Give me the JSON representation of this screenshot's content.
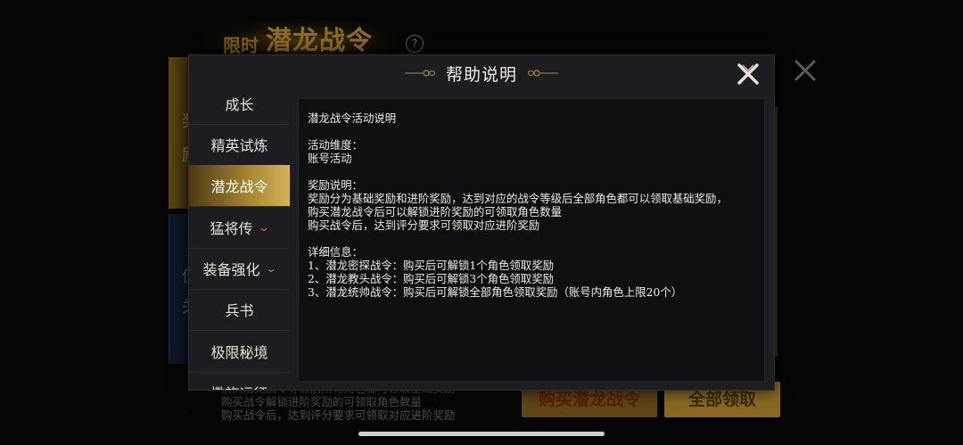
{
  "background": {
    "title_small": "限时",
    "title_large": "潜龙战令",
    "help_icon": "?",
    "left_panel_chars_top": [
      "奖",
      "励"
    ],
    "left_panel_chars_bottom": [
      "值",
      "关"
    ],
    "behind_text": [
      "购买潜龙战令等级后所有角色都可领取基础奖励",
      "购买战令解锁进阶奖励的可领取角色数量",
      "购买战令后，达到评分要求可领取对应进阶奖励"
    ],
    "buy_button": "购买潜龙战令",
    "claim_all_button": "全部领取"
  },
  "dialog": {
    "title": "帮助说明",
    "close_icon": "close-x-icon",
    "sidebar": [
      {
        "label": "成长",
        "active": false,
        "chevron": false
      },
      {
        "label": "精英试炼",
        "active": false,
        "chevron": false
      },
      {
        "label": "潜龙战令",
        "active": true,
        "chevron": false
      },
      {
        "label": "猛将传",
        "active": false,
        "chevron": true
      },
      {
        "label": "装备强化",
        "active": false,
        "chevron": true
      },
      {
        "label": "兵书",
        "active": false,
        "chevron": false
      },
      {
        "label": "极限秘境",
        "active": false,
        "chevron": false
      },
      {
        "label": "撒族远征",
        "active": false,
        "chevron": false
      }
    ],
    "content": {
      "heading": "潜龙战令活动说明",
      "dimension_label": "活动维度：",
      "dimension_value": "账号活动",
      "reward_label": "奖励说明：",
      "reward_lines": [
        "奖励分为基础奖励和进阶奖励，达到对应的战令等级后全部角色都可以领取基础奖励，",
        "购买潜龙战令后可以解锁进阶奖励的可领取角色数量",
        "购买战令后，达到评分要求可领取对应进阶奖励"
      ],
      "detail_label": "详细信息：",
      "detail_lines": [
        "1、潜龙密探战令：购买后可解锁1个角色领取奖励",
        "2、潜龙教头战令：购买后可解锁3个角色领取奖励",
        "3、潜龙统帅战令：购买后可解锁全部角色领取奖励（账号内角色上限20个）"
      ]
    }
  },
  "colors": {
    "gold_accent": "#d5b359",
    "dialog_bg": "#1c1c21",
    "content_bg": "#0f0f12"
  }
}
